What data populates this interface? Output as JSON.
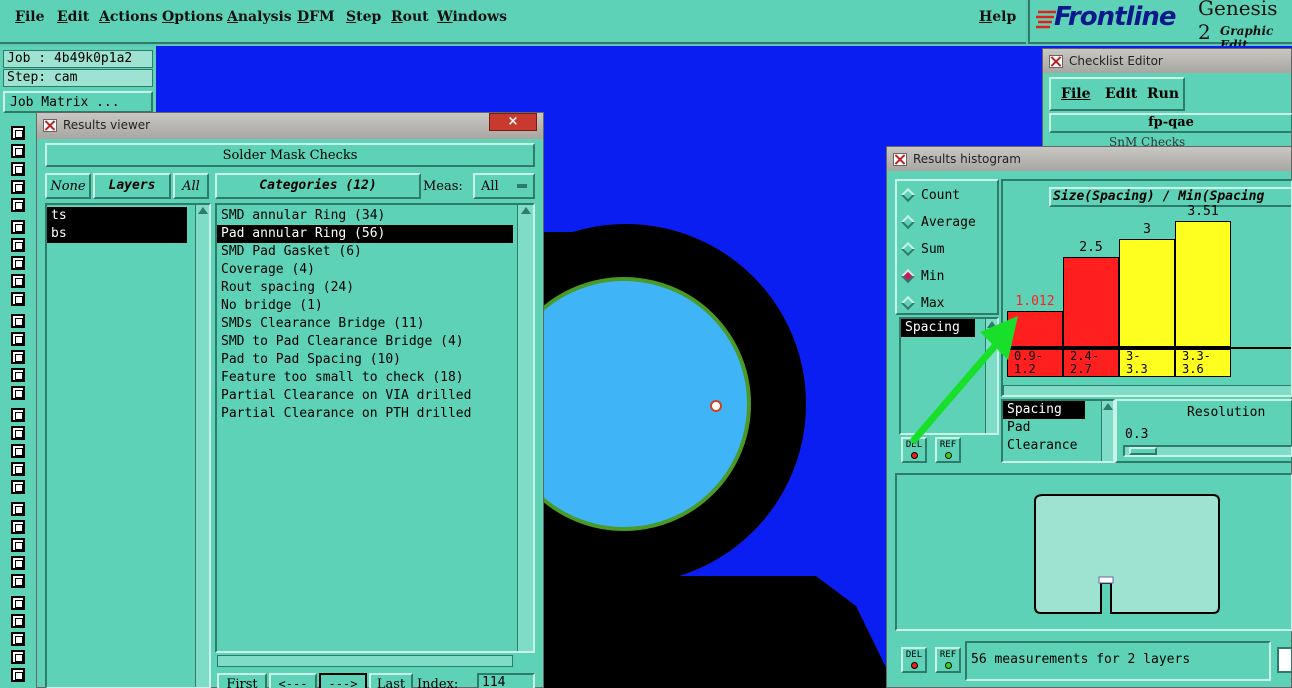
{
  "menu": {
    "items": [
      "File",
      "Edit",
      "Actions",
      "Options",
      "Analysis",
      "DFM",
      "Step",
      "Rout",
      "Windows"
    ],
    "help": "Help"
  },
  "brand": {
    "logo": "Frontline",
    "product": "Genesis 2",
    "subtitle": "Graphic Edit"
  },
  "job": {
    "job_label": "Job : 4b49k0p1a2",
    "step_label": "Step: cam",
    "matrix_button": "Job Matrix ..."
  },
  "results_viewer": {
    "title": "Results viewer",
    "header": "Solder Mask Checks",
    "none_label": "None",
    "layers_label": "Layers",
    "all_label": "All",
    "categories_label": "Categories (12)",
    "meas_label": "Meas:",
    "meas_value": "All",
    "layers": [
      "ts",
      "bs"
    ],
    "categories": [
      "SMD annular Ring (34)",
      "Pad annular Ring (56)",
      "SMD Pad Gasket (6)",
      "Coverage (4)",
      "Rout spacing (24)",
      "No bridge (1)",
      "SMDs Clearance Bridge (11)",
      "SMD to Pad Clearance Bridge (4)",
      "Pad to Pad Spacing (10)",
      "Feature too small to check (18)",
      "Partial Clearance on VIA drilled",
      "Partial Clearance on PTH drilled"
    ],
    "selected_category_index": 1,
    "nav": {
      "first": "First",
      "prev": "<---",
      "next": "--->",
      "last": "Last",
      "index_label": "Index:",
      "index_value": "114"
    }
  },
  "checklist_editor": {
    "title": "Checklist Editor",
    "menu": [
      "File",
      "Edit",
      "Run"
    ],
    "checklist_name": "fp-qae",
    "row": "SnM Checks"
  },
  "histogram": {
    "title": "Results histogram",
    "modes": [
      "Count",
      "Average",
      "Sum",
      "Min",
      "Max"
    ],
    "selected_mode": "Min",
    "list1": [
      "Spacing"
    ],
    "list2": [
      "Spacing",
      "Pad",
      "Clearance"
    ],
    "resolution_label": "Resolution",
    "resolution_value": "0.3",
    "del_label": "DEL",
    "ref_label": "REF",
    "status": "56 measurements for 2 layers"
  },
  "chart_data": {
    "type": "bar",
    "title": "Size(Spacing) / Min(Spacing",
    "categories": [
      "0.9-\n1.2",
      "2.4-\n2.7",
      "3-\n3.3",
      "3.3-\n3.6"
    ],
    "values": [
      1.012,
      2.5,
      3,
      3.51
    ],
    "value_labels": [
      "1.012",
      "2.5",
      "3",
      "3.51"
    ],
    "colors": [
      "#ff1f1f",
      "#ff1f1f",
      "#ffff1f",
      "#ffff1f"
    ],
    "value_label_colors": [
      "#ff1f1f",
      "#000000",
      "#000000",
      "#000000"
    ],
    "ylim": [
      0,
      3.51
    ]
  },
  "colors": {
    "panel": "#5ed2b6",
    "canvas": "#0b1ef2",
    "pad_fill": "#3fb4f6",
    "arrow": "#18e02a"
  }
}
